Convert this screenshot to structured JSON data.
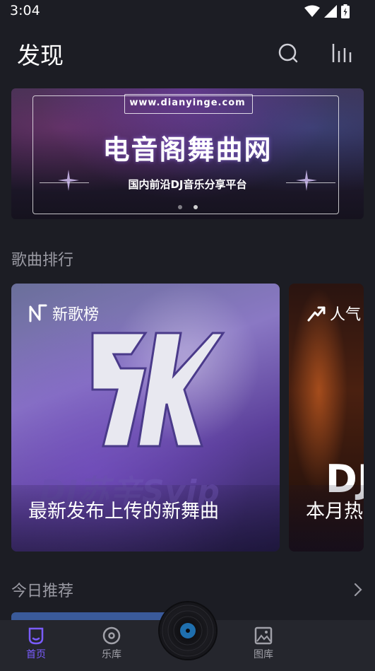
{
  "status_bar": {
    "time": "3:04"
  },
  "header": {
    "title": "发现"
  },
  "banner": {
    "url": "www.dianyinge.com",
    "title": "电音阁舞曲网",
    "subtitle": "国内前沿DJ音乐分享平台",
    "page_count": 2,
    "active_page": 2
  },
  "rankings": {
    "section_title": "歌曲排行",
    "cards": [
      {
        "label": "新歌榜",
        "caption": "最新发布上传的新舞曲",
        "art_text": "DJ苏辛Svip"
      },
      {
        "label": "人气",
        "caption": "本月热",
        "art_text": "DJ"
      }
    ]
  },
  "recommend": {
    "section_title": "今日推荐"
  },
  "bottom_nav": {
    "items": [
      {
        "label": "首页",
        "icon": "home-icon",
        "active": true
      },
      {
        "label": "乐库",
        "icon": "disc-icon",
        "active": false
      },
      {
        "label": "图库",
        "icon": "image-icon",
        "active": false
      }
    ],
    "center": "vinyl-player-icon"
  },
  "colors": {
    "background": "#1c1d24",
    "accent": "#7a5cff",
    "nav_bg": "#25262d",
    "muted_text": "#9a9aa3"
  }
}
